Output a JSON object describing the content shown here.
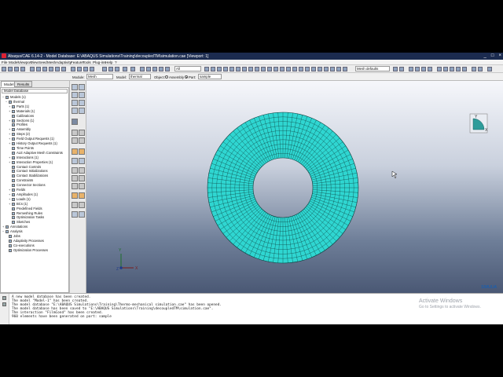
{
  "window": {
    "title": "Abaqus/CAE 6.14-2 - Model Database: E:\\ABAQUS Simulations\\Training\\decoupledTM\\simulation.cae [Viewport: 1]",
    "controls": [
      "_",
      "□",
      "×"
    ]
  },
  "menu": [
    "File",
    "Model",
    "Viewport",
    "View",
    "Seed",
    "Mesh",
    "Adaptivity",
    "Feature",
    "Tools",
    "Plug-ins",
    "Help",
    "?"
  ],
  "toolbar": {
    "all_combo": "All",
    "mesh_defaults": "Mesh defaults"
  },
  "context": {
    "module_label": "Module:",
    "module_value": "Mesh",
    "model_label": "Model:",
    "model_value": "thermal",
    "object_label": "Object:",
    "assembly_label": "Assembly",
    "part_label": "Part:",
    "part_value": "sample"
  },
  "tabs": [
    "Model",
    "Results"
  ],
  "tree": {
    "header": "Model Database",
    "rows": [
      {
        "pm": "−",
        "label": "Models (1)"
      },
      {
        "pm": "−",
        "label": "thermal"
      },
      {
        "pm": "+",
        "label": "Parts (1)"
      },
      {
        "pm": "+",
        "label": "Materials (1)"
      },
      {
        "pm": "",
        "label": "Calibrations"
      },
      {
        "pm": "+",
        "label": "Sections (1)"
      },
      {
        "pm": "",
        "label": "Profiles"
      },
      {
        "pm": "+",
        "label": "Assembly"
      },
      {
        "pm": "+",
        "label": "Steps (2)"
      },
      {
        "pm": "+",
        "label": "Field Output Requests (1)"
      },
      {
        "pm": "+",
        "label": "History Output Requests (1)"
      },
      {
        "pm": "",
        "label": "Time Points"
      },
      {
        "pm": "",
        "label": "ALE Adaptive Mesh Constraints"
      },
      {
        "pm": "+",
        "label": "Interactions (1)"
      },
      {
        "pm": "+",
        "label": "Interaction Properties (1)"
      },
      {
        "pm": "",
        "label": "Contact Controls"
      },
      {
        "pm": "",
        "label": "Contact Initializations"
      },
      {
        "pm": "",
        "label": "Contact Stabilizations"
      },
      {
        "pm": "",
        "label": "Constraints"
      },
      {
        "pm": "",
        "label": "Connector Sections"
      },
      {
        "pm": "+",
        "label": "Fields"
      },
      {
        "pm": "+",
        "label": "Amplitudes (1)"
      },
      {
        "pm": "+",
        "label": "Loads (1)"
      },
      {
        "pm": "+",
        "label": "BCs (1)"
      },
      {
        "pm": "",
        "label": "Predefined Fields"
      },
      {
        "pm": "",
        "label": "Remeshing Rules"
      },
      {
        "pm": "",
        "label": "Optimization Tasks"
      },
      {
        "pm": "",
        "label": "Sketches"
      },
      {
        "pm": "+",
        "label": "Annotations"
      },
      {
        "pm": "−",
        "label": "Analysis"
      },
      {
        "pm": "",
        "label": "Jobs"
      },
      {
        "pm": "",
        "label": "Adaptivity Processes"
      },
      {
        "pm": "",
        "label": "Co-executions"
      },
      {
        "pm": "",
        "label": "Optimization Processes"
      }
    ]
  },
  "viewport": {
    "triad_y": "Y",
    "triad_x": "X",
    "triad_z": "Z",
    "logo": "SIMULIA",
    "mesh_color": "#2fd6d1"
  },
  "messages": [
    "A new model database has been created.",
    "The model \"Model-1\" has been created.",
    "The model database \"E:\\ABAQUS Simulations\\Training\\Thermo-mechanical simulation.cae\" has been opened.",
    "The model database has been saved to \"E:\\ABAQUS Simulations\\Training\\decoupledTM\\simulation.cae\".",
    "The interaction \"FilmCond\" has been created.",
    "960 elements have been generated on part: sample"
  ],
  "windows_notice": {
    "title": "Activate Windows",
    "subtitle": "Go to Settings to activate Windows."
  }
}
